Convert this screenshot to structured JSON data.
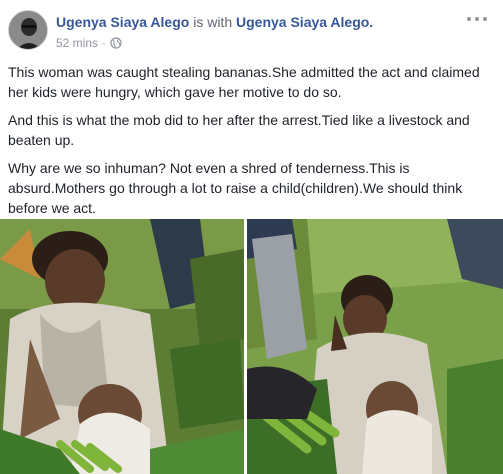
{
  "post": {
    "author": "Ugenya Siaya Alego",
    "with_text": "is with",
    "tagged": "Ugenya Siaya Alego.",
    "time": "52 mins",
    "separator": "·",
    "privacy_icon": "globe-icon",
    "more_icon": "more-options-icon",
    "paragraphs": [
      "This woman was caught stealing bananas.She admitted the act and claimed her kids were hungry, which gave her motive to do so.",
      "And this is what the mob did to her after the arrest.Tied like a livestock and beaten up.",
      "Why are we so inhuman? Not even a shred of tenderness.This is absurd.Mothers go through a lot to raise a child(children).We should think before we act."
    ]
  },
  "colors": {
    "link": "#365899",
    "meta": "#90949c",
    "text": "#1d2129"
  }
}
